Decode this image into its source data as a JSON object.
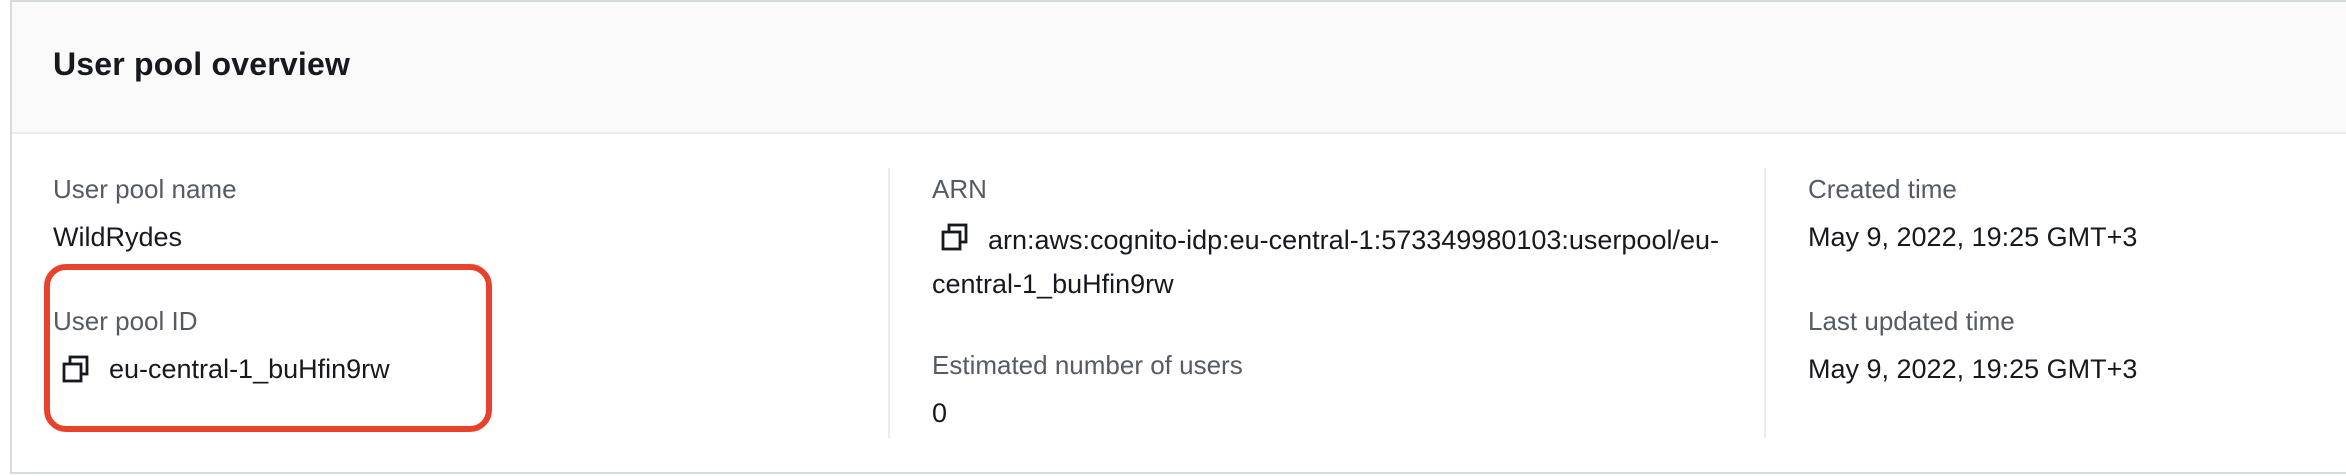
{
  "panel": {
    "title": "User pool overview"
  },
  "overview": {
    "user_pool_name": {
      "label": "User pool name",
      "value": "WildRydes"
    },
    "user_pool_id": {
      "label": "User pool ID",
      "value": "eu-central-1_buHfin9rw",
      "icon": "copy-icon"
    },
    "arn": {
      "label": "ARN",
      "value": "arn:aws:cognito-idp:eu-central-1:573349980103:userpool/eu-central-1_buHfin9rw",
      "icon": "copy-icon"
    },
    "estimated_users": {
      "label": "Estimated number of users",
      "value": "0"
    },
    "created_time": {
      "label": "Created time",
      "value": "May 9, 2022, 19:25 GMT+3"
    },
    "last_updated_time": {
      "label": "Last updated time",
      "value": "May 9, 2022, 19:25 GMT+3"
    }
  },
  "colors": {
    "highlight": "#e8412c",
    "label": "#545b64",
    "value": "#16191f",
    "border": "#d5dbdb"
  }
}
